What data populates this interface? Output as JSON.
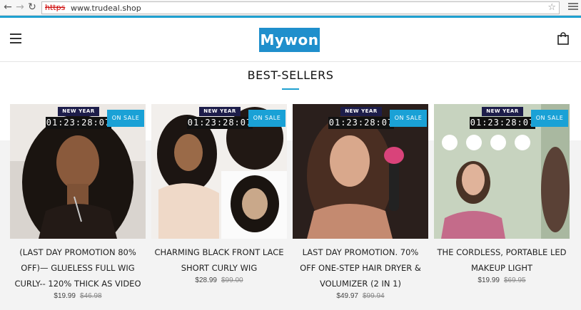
{
  "browser": {
    "url_protocol": "https",
    "url": "www.trudeal.shop"
  },
  "header": {
    "logo_text": "Mywon"
  },
  "section": {
    "title": "BEST-SELLERS"
  },
  "products": [
    {
      "badge_new_year": "NEW YEAR",
      "countdown": "01:23:28:07",
      "sale_label": "ON SALE",
      "title": "(LAST DAY PROMOTION 80% OFF)— GLUELESS FULL WIG CURLY-- 120% THICK AS VIDEO",
      "price": "$19.99",
      "compare_price": "$46.98"
    },
    {
      "badge_new_year": "NEW YEAR",
      "countdown": "01:23:28:07",
      "sale_label": "ON SALE",
      "title": "CHARMING BLACK FRONT LACE SHORT CURLY WIG",
      "price": "$28.99",
      "compare_price": "$99.00"
    },
    {
      "badge_new_year": "NEW YEAR",
      "countdown": "01:23:28:07",
      "sale_label": "ON SALE",
      "title": "LAST DAY PROMOTION. 70% OFF ONE-STEP HAIR DRYER & VOLUMIZER (2 IN 1)",
      "price": "$49.97",
      "compare_price": "$99.94"
    },
    {
      "badge_new_year": "NEW YEAR",
      "countdown": "01:23:28:07",
      "sale_label": "ON SALE",
      "title": "THE CORDLESS, PORTABLE LED MAKEUP LIGHT",
      "price": "$19.99",
      "compare_price": "$69.95"
    }
  ],
  "colors": {
    "accent": "#1fa0d0",
    "logo_bg": "#1f8fcc",
    "sale_badge": "#1aa1d6"
  }
}
